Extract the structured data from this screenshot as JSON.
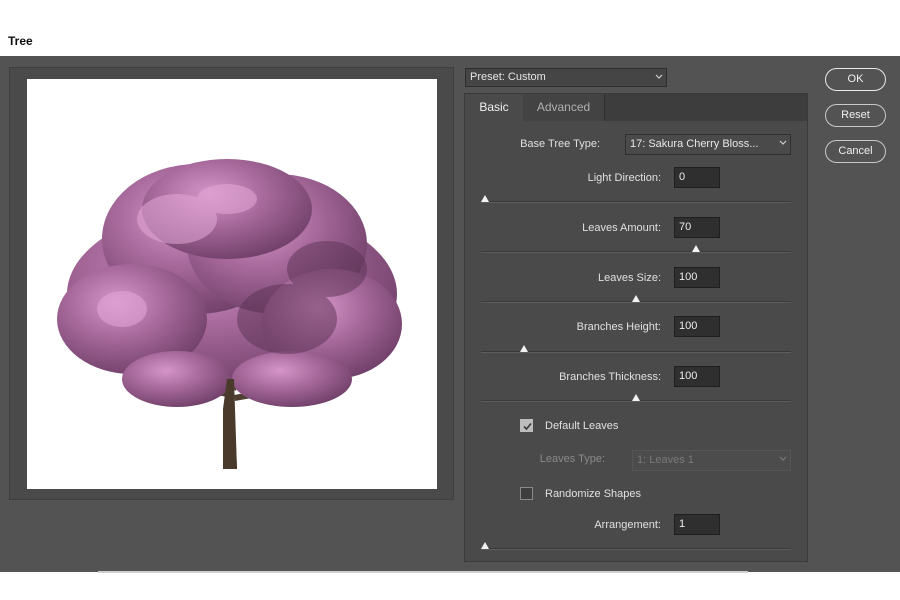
{
  "window": {
    "title": "Tree"
  },
  "preset": {
    "label": "Preset: Custom"
  },
  "tabs": [
    {
      "label": "Basic"
    },
    {
      "label": "Advanced"
    }
  ],
  "basic": {
    "base_tree_type": {
      "label": "Base Tree Type:",
      "value": "17: Sakura Cherry Bloss..."
    },
    "light_direction": {
      "label": "Light Direction:",
      "value": "0",
      "slider_fraction": 0.0
    },
    "leaves_amount": {
      "label": "Leaves Amount:",
      "value": "70",
      "slider_fraction": 0.7
    },
    "leaves_size": {
      "label": "Leaves Size:",
      "value": "100",
      "slider_fraction": 0.5
    },
    "branches_height": {
      "label": "Branches Height:",
      "value": "100",
      "slider_fraction": 0.13
    },
    "branches_thickness": {
      "label": "Branches Thickness:",
      "value": "100",
      "slider_fraction": 0.5
    },
    "default_leaves": {
      "label": "Default Leaves",
      "checked": true
    },
    "leaves_type": {
      "label": "Leaves Type:",
      "value": "1: Leaves 1",
      "disabled": true
    },
    "randomize_shapes": {
      "label": "Randomize Shapes",
      "checked": false
    },
    "arrangement": {
      "label": "Arrangement:",
      "value": "1",
      "slider_fraction": 0.0
    }
  },
  "buttons": {
    "ok": "OK",
    "reset": "Reset",
    "cancel": "Cancel"
  },
  "colors": {
    "dialog_bg": "#535353",
    "panel_bg": "#4a4a4a",
    "field_bg": "#2f2f2f",
    "blossom": "#a35d94"
  }
}
